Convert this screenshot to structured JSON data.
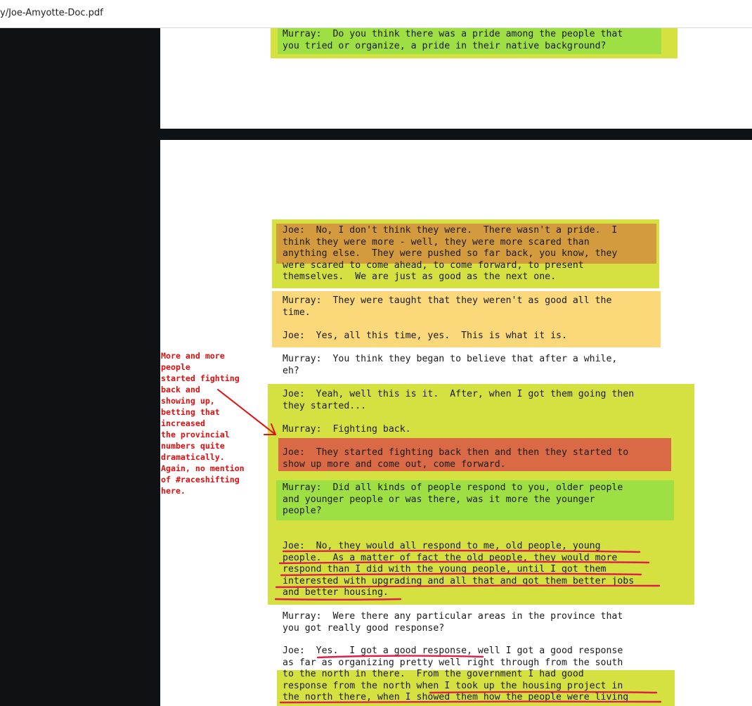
{
  "window": {
    "title": "y/Joe-Amyotte-Doc.pdf"
  },
  "colors": {
    "yellow_green": "#d5e141",
    "green": "#9ee043",
    "orange": "#d49a3e",
    "light_orange": "#fbd97a",
    "red_orange": "#d96a45",
    "annotation_red": "#e01010",
    "underline": "#dd1f4a"
  },
  "transcript": {
    "p1_murray": "Murray:  Do you think there was a pride among the people that\nyou tried or organize, a pride in their native background?",
    "joe_pride": "Joe:  No, I don't think they were.  There wasn't a pride.  I\nthink they were more - well, they were more scared than\nanything else.  They were pushed so far back, you know, they\nwere scared to come ahead, to come forward, to present\nthemselves.  We are just as good as the next one.",
    "murray_taught": "Murray:  They were taught that they weren't as good all the\ntime.",
    "joe_alltime": "Joe:  Yes, all this time, yes.  This is what it is.",
    "murray_believe": "Murray:  You think they began to believe that after a while,\neh?",
    "joe_yeah": "Joe:  Yeah, well this is it.  After, when I got them going then\nthey started...",
    "murray_fighting": "Murray:  Fighting back.",
    "joe_started": "Joe:  They started fighting back then and then they started to\nshow up more and come out, come forward.",
    "murray_kinds": "Murray:  Did all kinds of people respond to you, older people\nand younger people or was there, was it more the younger\npeople?",
    "joe_respond": "Joe:  No, they would all respond to me, old people, young\npeople.  As a matter of fact the old people, they would more\nrespond than I did with the young people, until I got them\ninterested with upgrading and all that and got them better jobs\nand better housing.",
    "murray_areas": "Murray:  Were there any particular areas in the province that\nyou got really good response?",
    "joe_yes": "Joe:  Yes.  I got a good response, well I got a good response\nas far as organizing pretty well right through from the south\nto the north in there.  From the government I had good\nresponse from the north when I took up the housing project in\nthe north there, when I showed them how the people were living"
  },
  "annotation": {
    "note": "More and more\npeople\nstarted fighting\nback and\nshowing up,\nbetting that\nincreased\nthe provincial\nnumbers quite\ndramatically.\nAgain, no mention\nof #raceshifting\nhere."
  }
}
